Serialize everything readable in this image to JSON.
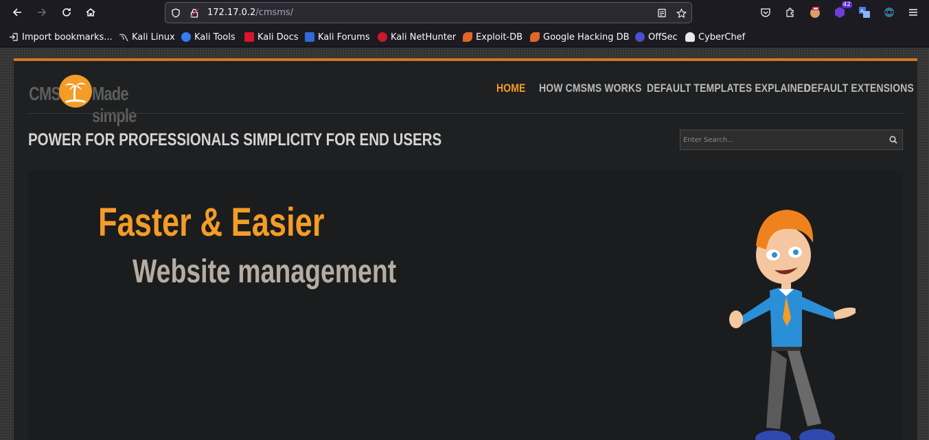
{
  "browser": {
    "url_host": "172.17.0.2",
    "url_path": "/cmsms/",
    "extension_badge": "42"
  },
  "bookmarks": [
    {
      "label": "Import bookmarks...",
      "icon": "import-icon"
    },
    {
      "label": "Kali Linux",
      "icon": "kali-icon"
    },
    {
      "label": "Kali Tools",
      "icon": "kali-tools-icon"
    },
    {
      "label": "Kali Docs",
      "icon": "kali-docs-icon"
    },
    {
      "label": "Kali Forums",
      "icon": "kali-forums-icon"
    },
    {
      "label": "Kali NetHunter",
      "icon": "nethunter-icon"
    },
    {
      "label": "Exploit-DB",
      "icon": "exploit-db-icon"
    },
    {
      "label": "Google Hacking DB",
      "icon": "ghdb-icon"
    },
    {
      "label": "OffSec",
      "icon": "offsec-icon"
    },
    {
      "label": "CyberChef",
      "icon": "cyberchef-icon"
    }
  ],
  "site": {
    "logo": {
      "left": "CMS",
      "right": "Made simple"
    },
    "nav": [
      {
        "label": "HOME",
        "active": true
      },
      {
        "label": "HOW CMSMS WORKS",
        "active": false
      },
      {
        "label": "DEFAULT TEMPLATES EXPLAINED",
        "active": false
      },
      {
        "label": "DEFAULT EXTENSIONS",
        "active": false
      }
    ],
    "tagline": "POWER FOR PROFESSIONALS SIMPLICITY FOR END USERS",
    "search_placeholder": "Enter Search...",
    "headline": "Faster & Easier",
    "subline": "Website management"
  },
  "colors": {
    "accent": "#f39c27",
    "page_bg": "#1f2021",
    "browser_bg": "#1c1b22"
  }
}
